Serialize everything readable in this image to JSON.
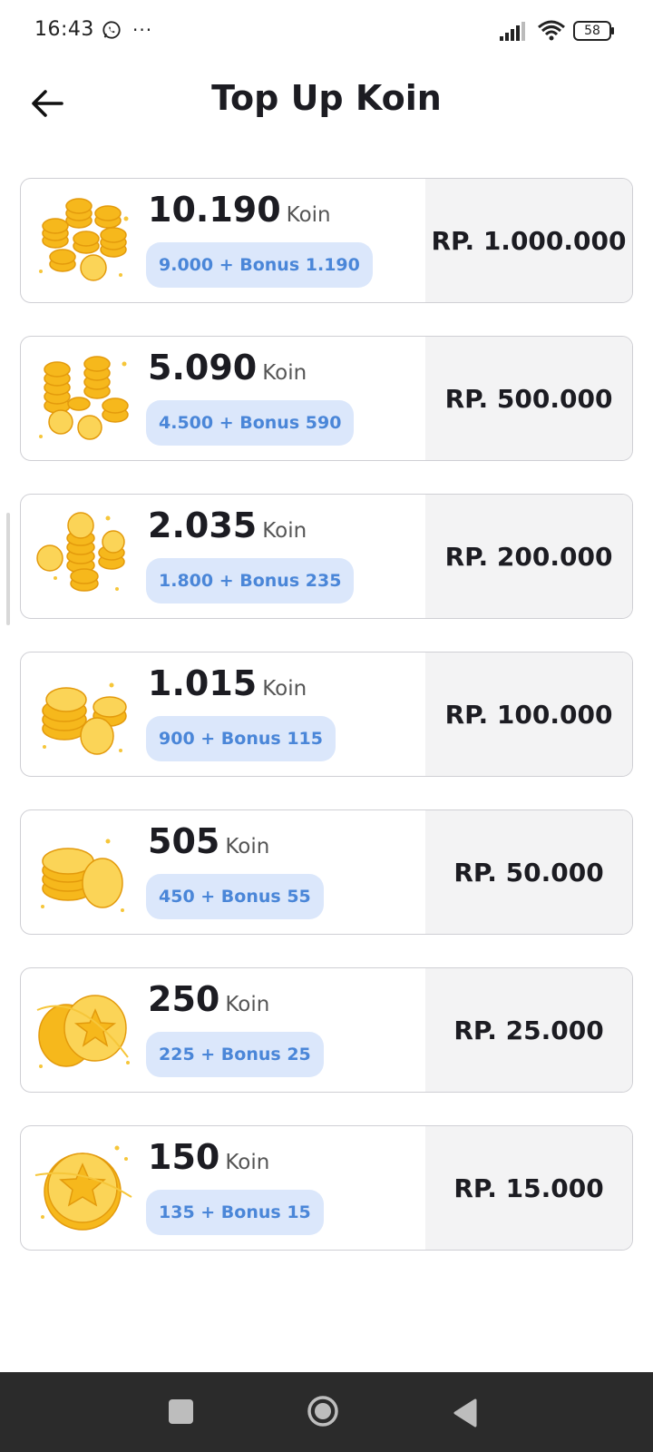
{
  "status_bar": {
    "time": "16:43",
    "more": "···",
    "battery": "58",
    "icons": [
      "whatsapp-icon",
      "more-dots-icon",
      "signal-icon",
      "wifi-icon",
      "battery-icon"
    ]
  },
  "header": {
    "title": "Top Up Koin",
    "back_icon": "arrow-left-icon"
  },
  "colors": {
    "bonus_background": "#dbe7fb",
    "bonus_text": "#4a86d8",
    "price_background": "#f3f3f4",
    "coin_gold": "#f6b81c"
  },
  "packages": [
    {
      "amount": "10.190",
      "unit": "Koin",
      "bonus": "9.000 + Bonus 1.190",
      "price": "RP. 1.000.000",
      "icon": "coin-pile-large-icon"
    },
    {
      "amount": "5.090",
      "unit": "Koin",
      "bonus": "4.500 + Bonus 590",
      "price": "RP. 500.000",
      "icon": "coin-stacks-icon"
    },
    {
      "amount": "2.035",
      "unit": "Koin",
      "bonus": "1.800 + Bonus 235",
      "price": "RP. 200.000",
      "icon": "coin-stacks-icon"
    },
    {
      "amount": "1.015",
      "unit": "Koin",
      "bonus": "900 + Bonus 115",
      "price": "RP. 100.000",
      "icon": "coin-stack-icon"
    },
    {
      "amount": "505",
      "unit": "Koin",
      "bonus": "450 + Bonus 55",
      "price": "RP. 50.000",
      "icon": "coin-stack-icon"
    },
    {
      "amount": "250",
      "unit": "Koin",
      "bonus": "225 + Bonus 25",
      "price": "RP. 25.000",
      "icon": "two-coins-icon"
    },
    {
      "amount": "150",
      "unit": "Koin",
      "bonus": "135 + Bonus 15",
      "price": "RP. 15.000",
      "icon": "single-coin-icon"
    }
  ],
  "nav_bar": {
    "icons": [
      "recents-square-icon",
      "home-circle-icon",
      "back-triangle-icon"
    ]
  }
}
